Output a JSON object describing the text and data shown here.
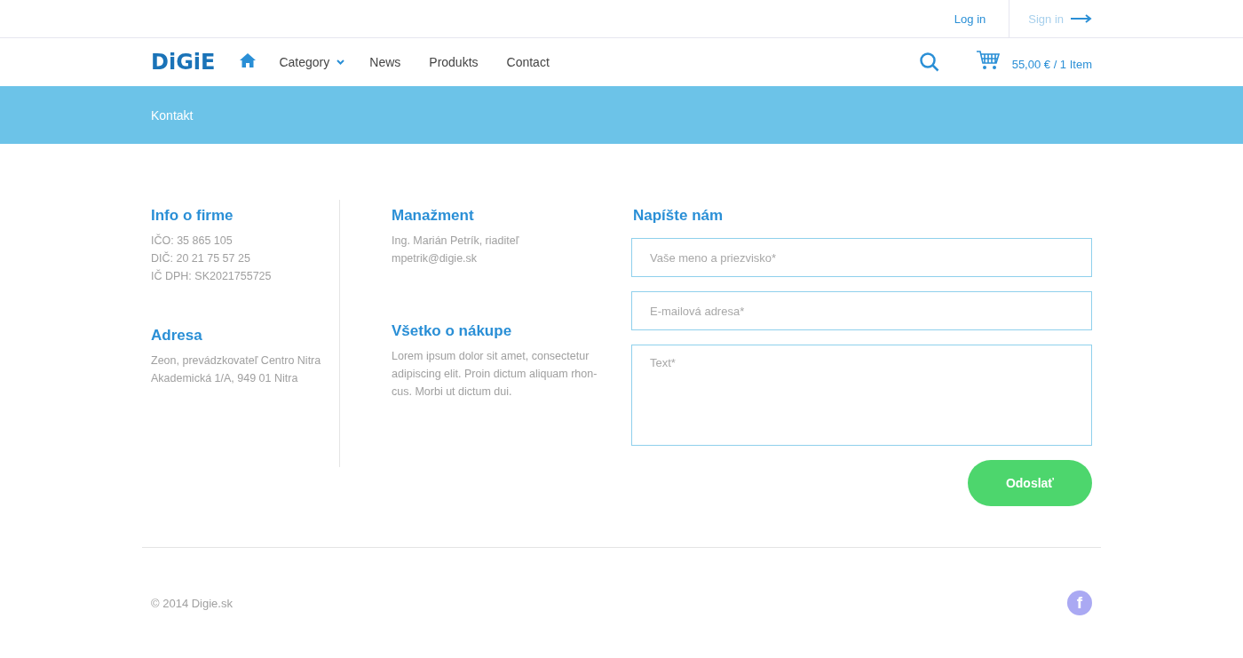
{
  "topbar": {
    "login": "Log in",
    "signin": "Sign in"
  },
  "header": {
    "logo": "DiGiE",
    "nav": [
      {
        "label": "Category",
        "kind": "dropdown"
      },
      {
        "label": "News",
        "kind": "link"
      },
      {
        "label": "Produkts",
        "kind": "link"
      },
      {
        "label": "Contact",
        "kind": "link"
      }
    ],
    "cart": "55,00 € / 1 Item"
  },
  "banner": {
    "title": "Kontakt"
  },
  "info": [
    {
      "heading": "Info o firme",
      "lines": [
        "IČO: 35 865 105",
        "DIČ: 20 21 75 57 25",
        "IČ DPH: SK2021755725"
      ]
    },
    {
      "heading": "Adresa",
      "lines": [
        "Zeon, prevádzkovateľ Centro Nitra",
        "Akademická 1/A, 949 01 Nitra"
      ]
    }
  ],
  "info2": [
    {
      "heading": "Manažment",
      "lines": [
        "Ing. Marián Petrík, riaditeľ",
        "mpetrik@digie.sk"
      ]
    },
    {
      "heading": "Všetko o nákupe",
      "lines": [
        "Lorem ipsum dolor sit amet, consectetur",
        "adipiscing elit. Proin dictum aliquam rhon-",
        "cus. Morbi ut dictum dui."
      ]
    }
  ],
  "form": {
    "heading": "Napíšte nám",
    "fields": [
      {
        "placeholder": "Vaše meno a priezvisko*",
        "kind": "input"
      },
      {
        "placeholder": "E-mailová adresa*",
        "kind": "input"
      },
      {
        "placeholder": "Text*",
        "kind": "textarea"
      }
    ],
    "submit": "Odoslať"
  },
  "footer": {
    "copyright": "© 2014 Digie.sk",
    "social": "f"
  }
}
